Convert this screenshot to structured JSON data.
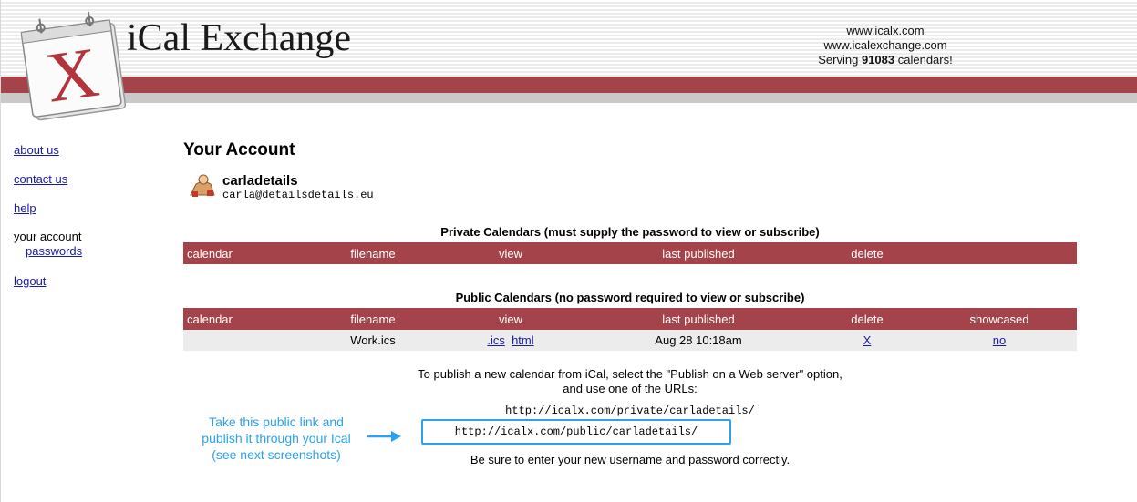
{
  "header": {
    "logo_text": "iCal Exchange",
    "site_line1": "www.icalx.com",
    "site_line2": "www.icalexchange.com",
    "serving_prefix": "Serving ",
    "serving_count": "91083",
    "serving_suffix": " calendars!"
  },
  "sidebar": {
    "about": "about us",
    "contact": "contact us",
    "help": "help",
    "your_account": "your account",
    "passwords": "passwords",
    "logout": "logout"
  },
  "page": {
    "title": "Your Account"
  },
  "user": {
    "name": "carladetails",
    "email": "carla@detailsdetails.eu"
  },
  "private": {
    "title": "Private Calendars (must supply the password to view or subscribe)",
    "columns": [
      "calendar",
      "filename",
      "view",
      "last published",
      "delete"
    ]
  },
  "public": {
    "title": "Public Calendars (no password required to view or subscribe)",
    "columns": [
      "calendar",
      "filename",
      "view",
      "last published",
      "delete",
      "showcased"
    ],
    "rows": [
      {
        "calendar": "",
        "filename": "Work.ics",
        "view_ics": ".ics",
        "view_html": "html",
        "last_published": "Aug 28 10:18am",
        "delete": "X",
        "showcased": "no"
      }
    ]
  },
  "instructions": {
    "line1": "To publish a new calendar from iCal, select the \"Publish on a Web server\" option,",
    "line2": "and use one of the URLs:",
    "private_url": "http://icalx.com/private/carladetails/",
    "public_url": "http://icalx.com/public/carladetails/",
    "note": "Be sure to enter your new username and password correctly."
  },
  "annotation": {
    "line1": "Take this public link and",
    "line2": "publish it through your Ical",
    "line3": "(see next screenshots)"
  },
  "colors": {
    "brand_red": "#a4444a",
    "annotation_blue": "#2aa2f0"
  }
}
